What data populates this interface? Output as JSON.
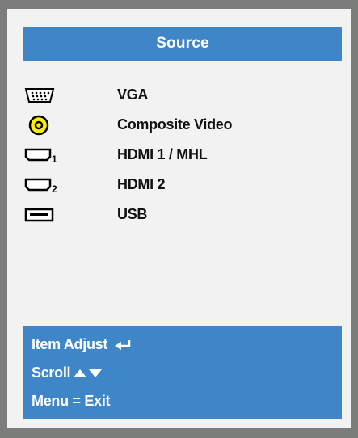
{
  "menu": {
    "title": "Source",
    "sources": [
      {
        "label": "VGA",
        "icon": "vga-icon"
      },
      {
        "label": "Composite Video",
        "icon": "composite-video-icon"
      },
      {
        "label": "HDMI 1 / MHL",
        "icon": "hdmi-1-icon"
      },
      {
        "label": "HDMI 2",
        "icon": "hdmi-2-icon"
      },
      {
        "label": "USB",
        "icon": "usb-icon"
      }
    ]
  },
  "footer": {
    "item_adjust": "Item Adjust",
    "scroll": "Scroll",
    "menu_exit": "Menu = Exit"
  },
  "icon_digits": {
    "hdmi1": "1",
    "hdmi2": "2"
  },
  "colors": {
    "frame": "#7b7d7b",
    "panel": "#f2f2f2",
    "accent_blue": "#3e86c8",
    "composite_yellow": "#ffee00"
  }
}
